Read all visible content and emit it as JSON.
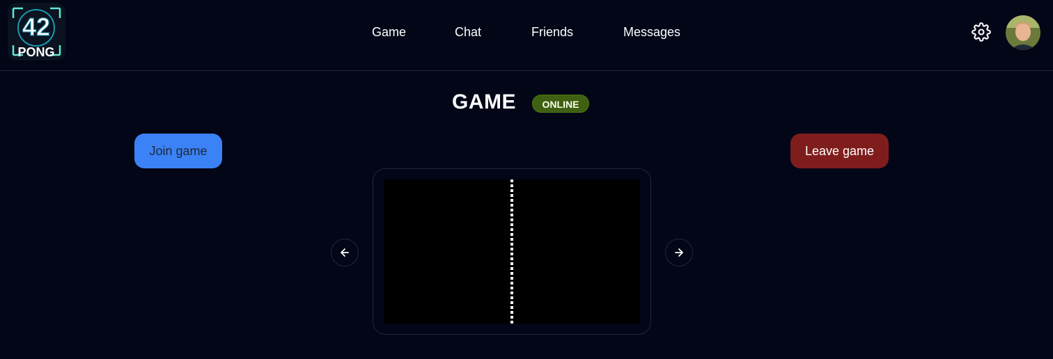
{
  "logo": {
    "line1": "42",
    "line2": "PONG"
  },
  "nav": {
    "items": [
      {
        "label": "Game"
      },
      {
        "label": "Chat"
      },
      {
        "label": "Friends"
      },
      {
        "label": "Messages"
      }
    ]
  },
  "header": {
    "settings_icon": "gear-icon",
    "avatar_icon": "user-avatar"
  },
  "page": {
    "title": "GAME",
    "status": "ONLINE",
    "status_color": "#3f5f12"
  },
  "actions": {
    "join_label": "Join game",
    "join_color": "#3b82f6",
    "leave_label": "Leave game",
    "leave_color": "#7f1d1d"
  },
  "carousel": {
    "prev_icon": "arrow-left-icon",
    "next_icon": "arrow-right-icon"
  }
}
